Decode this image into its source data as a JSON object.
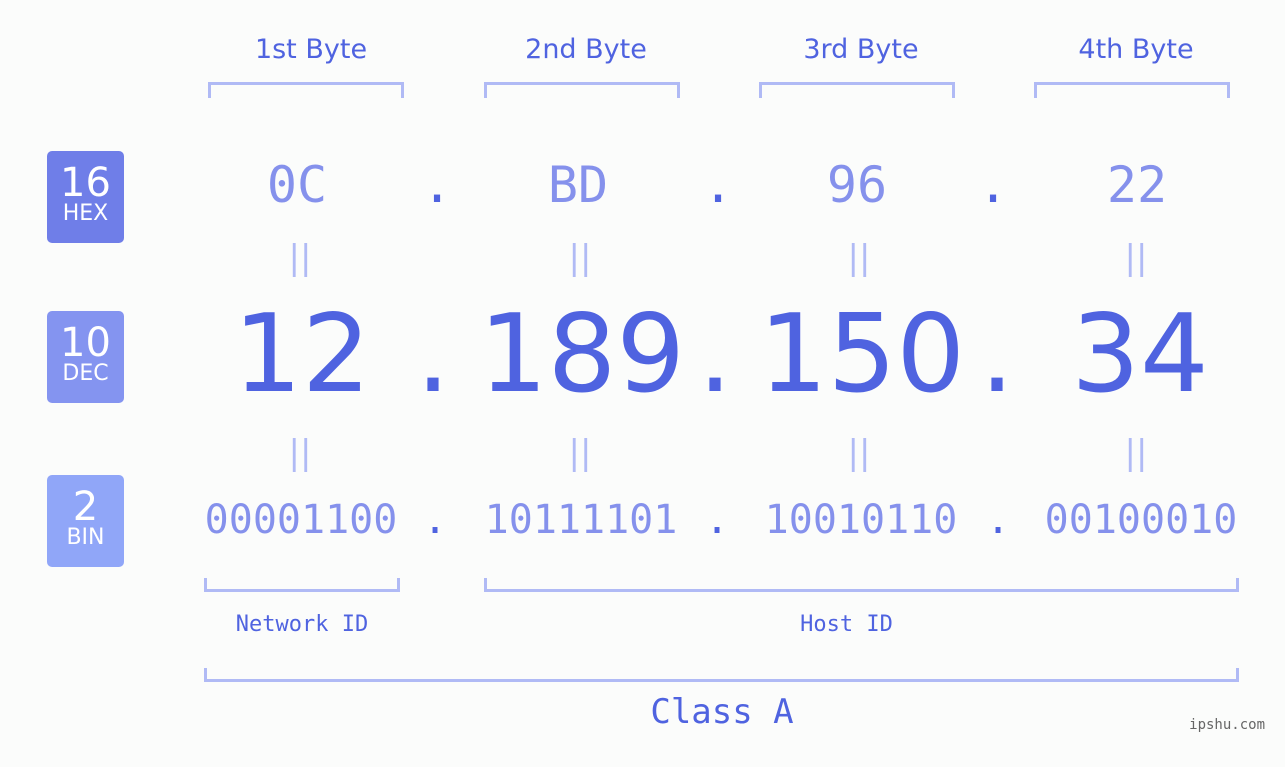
{
  "bytes": {
    "labels": [
      "1st Byte",
      "2nd Byte",
      "3rd Byte",
      "4th Byte"
    ],
    "hex": [
      "0C",
      "BD",
      "96",
      "22"
    ],
    "dec": [
      "12",
      "189",
      "150",
      "34"
    ],
    "bin": [
      "00001100",
      "10111101",
      "10010110",
      "00100010"
    ]
  },
  "separator": ".",
  "equals": "||",
  "badges": {
    "hex": {
      "num": "16",
      "label": "HEX",
      "color": "#6f7ee8"
    },
    "dec": {
      "num": "10",
      "label": "DEC",
      "color": "#8494f0"
    },
    "bin": {
      "num": "2",
      "label": "BIN",
      "color": "#90a6f8"
    }
  },
  "segments": {
    "network": "Network ID",
    "host": "Host ID",
    "class": "Class A"
  },
  "watermark": "ipshu.com"
}
